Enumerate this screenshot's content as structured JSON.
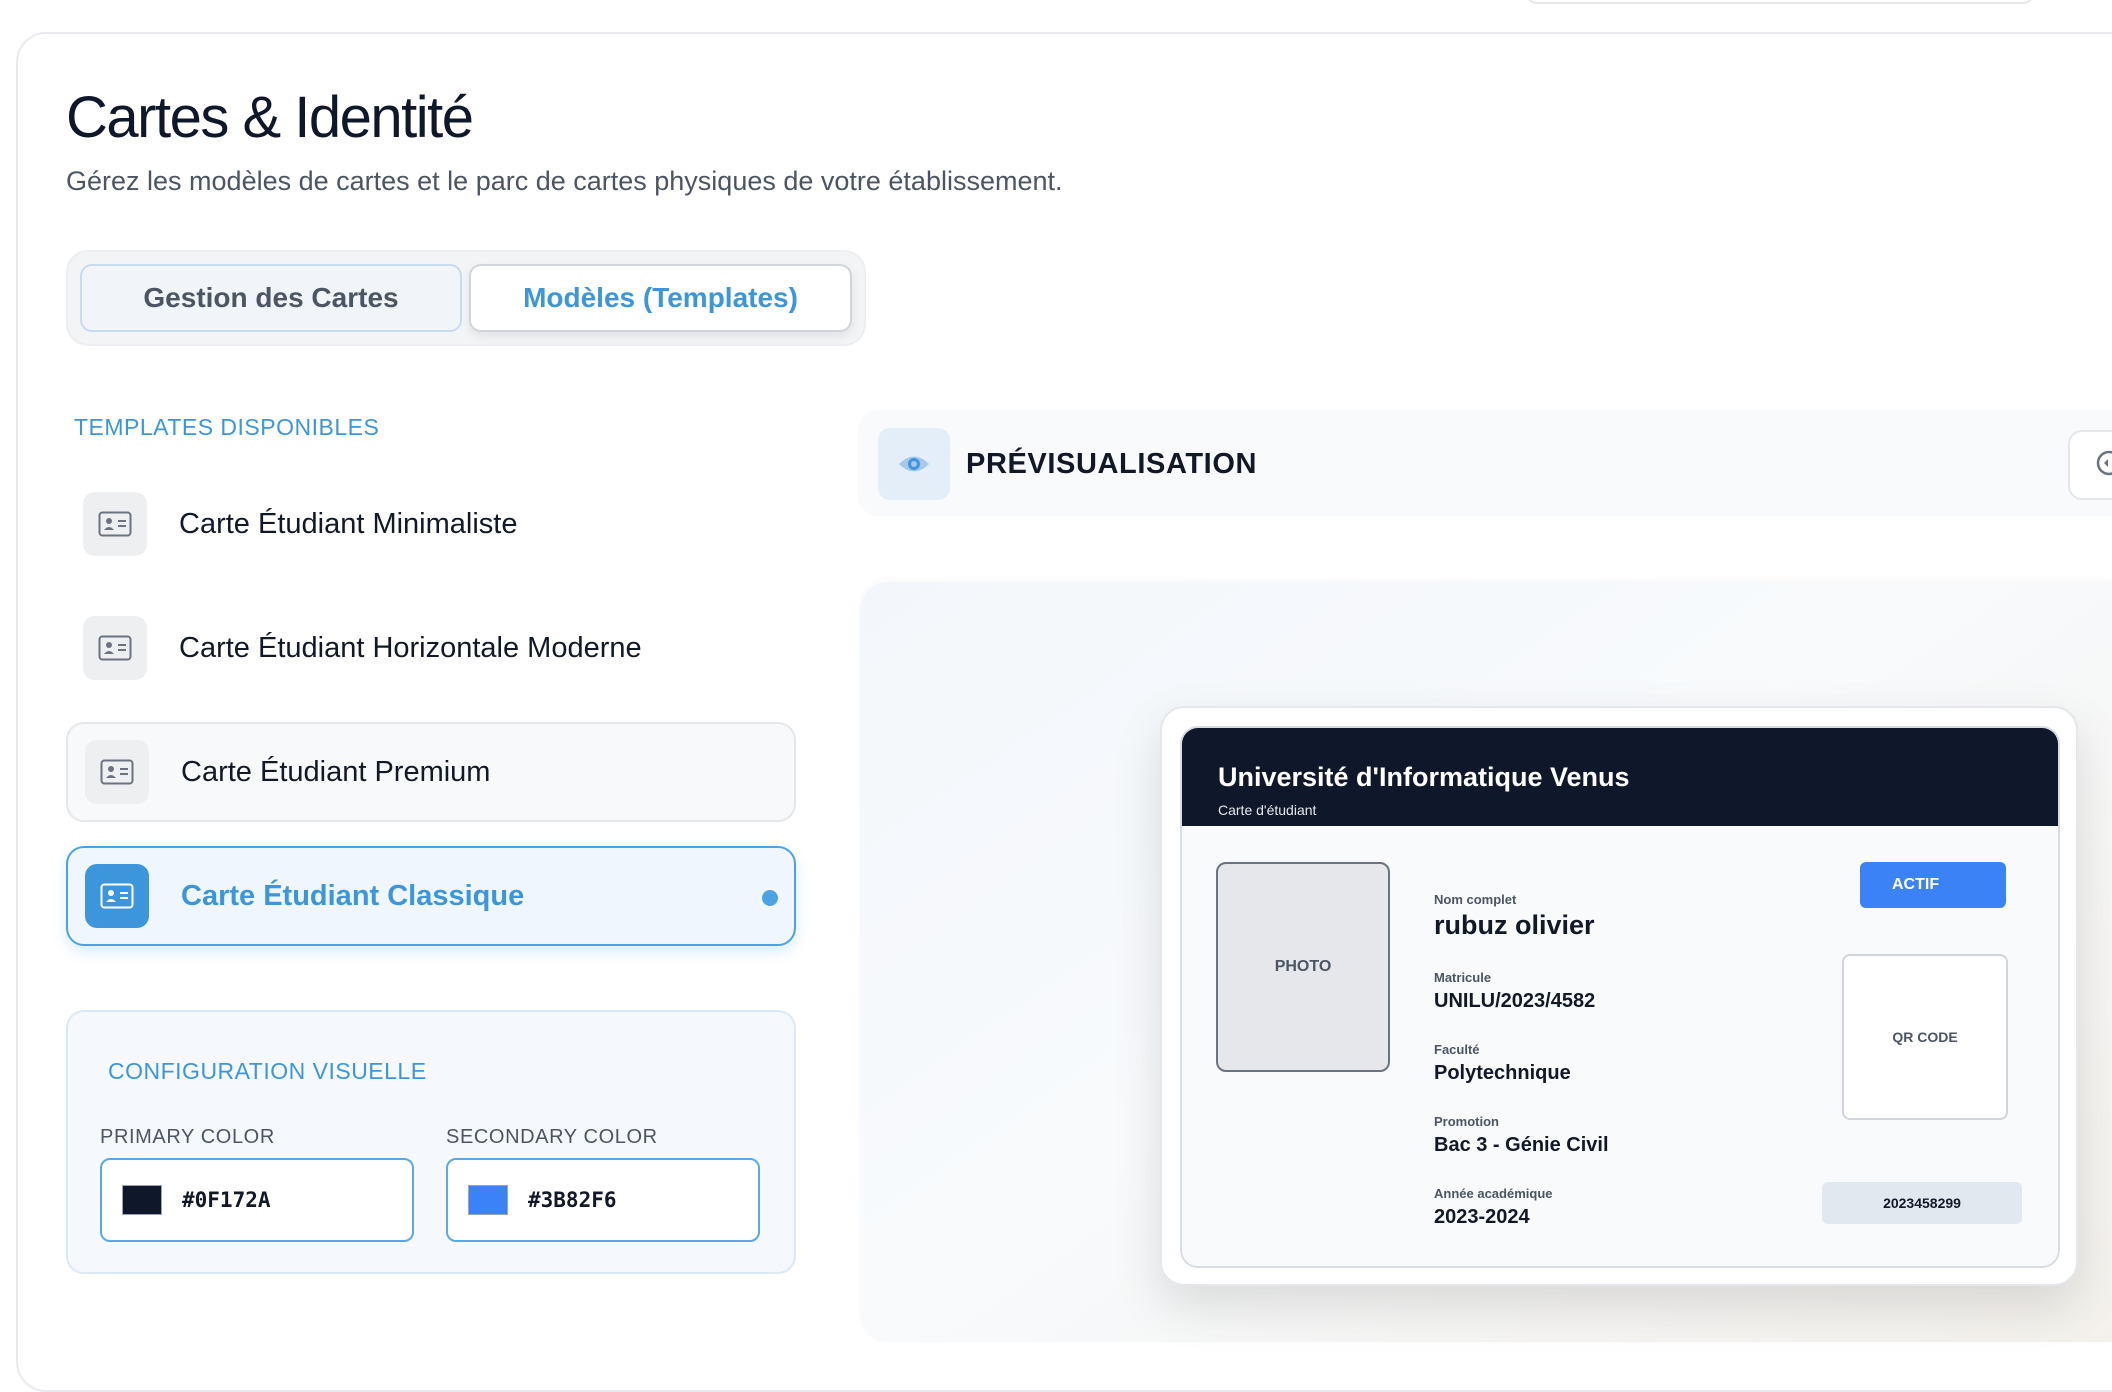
{
  "page": {
    "title": "Cartes & Identité",
    "subtitle": "Gérez les modèles de cartes et le parc de cartes physiques de votre établissement."
  },
  "tabs": [
    {
      "label": "Gestion des Cartes",
      "active": false
    },
    {
      "label": "Modèles (Templates)",
      "active": true
    }
  ],
  "templates": {
    "section_label": "TEMPLATES DISPONIBLES",
    "items": [
      {
        "label": "Carte Étudiant Minimaliste",
        "state": "default",
        "icon": "id-card-icon"
      },
      {
        "label": "Carte Étudiant Horizontale Moderne",
        "state": "default",
        "icon": "id-card-icon"
      },
      {
        "label": "Carte Étudiant Premium",
        "state": "hover",
        "icon": "id-card-icon"
      },
      {
        "label": "Carte Étudiant Classique",
        "state": "selected",
        "icon": "id-card-icon"
      }
    ]
  },
  "config": {
    "section_label": "CONFIGURATION VISUELLE",
    "primary": {
      "label": "PRIMARY COLOR",
      "value": "#0F172A",
      "swatch": "#0F172A"
    },
    "secondary": {
      "label": "SECONDARY COLOR",
      "value": "#3B82F6",
      "swatch": "#3B82F6"
    }
  },
  "preview": {
    "title": "PRÉVISUALISATION",
    "icon": "eye-icon",
    "action_icon": "refresh-icon"
  },
  "card": {
    "university": "Université d'Informatique Venus",
    "card_type": "Carte d'étudiant",
    "photo_placeholder": "PHOTO",
    "status": "ACTIF",
    "qr_placeholder": "QR CODE",
    "barcode_number": "2023458299",
    "fields": [
      {
        "label": "Nom complet",
        "value": "rubuz olivier"
      },
      {
        "label": "Matricule",
        "value": "UNILU/2023/4582"
      },
      {
        "label": "Faculté",
        "value": "Polytechnique"
      },
      {
        "label": "Promotion",
        "value": "Bac 3 - Génie Civil"
      },
      {
        "label": "Année académique",
        "value": "2023-2024"
      }
    ]
  },
  "colors": {
    "accent": "#3D96DC",
    "card_header": "#0F172A",
    "status_badge": "#3B82F6"
  }
}
